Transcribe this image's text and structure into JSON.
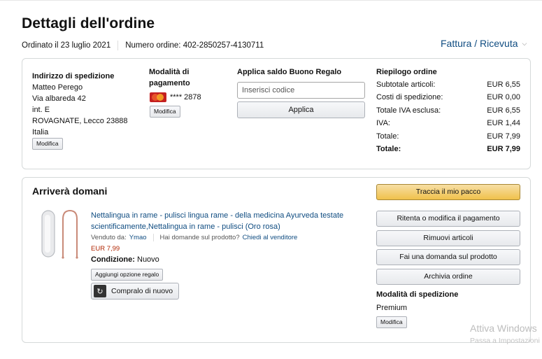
{
  "page": {
    "title": "Dettagli dell'ordine",
    "order_date": "Ordinato il 23 luglio 2021",
    "order_number": "Numero ordine: 402-2850257-4130711",
    "invoice_link": "Fattura / Ricevuta"
  },
  "shipping_address": {
    "label": "Indirizzo di spedizione",
    "lines": [
      "Matteo Perego",
      "Via albareda 42",
      "int. E",
      "ROVAGNATE, Lecco 23888",
      "Italia"
    ],
    "edit_button": "Modifica"
  },
  "payment": {
    "label": "Modalità di pagamento",
    "card_masked": "**** 2878",
    "card_brand_icon": "mastercard-icon",
    "edit_button": "Modifica"
  },
  "gift_card": {
    "label": "Applica saldo Buono Regalo",
    "placeholder": "Inserisci codice",
    "value": "",
    "apply_button": "Applica"
  },
  "summary": {
    "label": "Riepilogo ordine",
    "rows": [
      {
        "name": "Subtotale articoli:",
        "value": "EUR 6,55"
      },
      {
        "name": "Costi di spedizione:",
        "value": "EUR 0,00"
      },
      {
        "name": "Totale IVA esclusa:",
        "value": "EUR 6,55"
      },
      {
        "name": "IVA:",
        "value": "EUR 1,44"
      },
      {
        "name": "Totale:",
        "value": "EUR 7,99"
      }
    ],
    "grand_total": {
      "name": "Totale:",
      "value": "EUR 7,99"
    }
  },
  "shipment": {
    "heading": "Arriverà domani",
    "product": {
      "title": "Nettalingua in rame - pulisci lingua rame - della medicina Ayurveda testate scientificamente,Nettalingua in rame - pulisci (Oro rosa)",
      "sold_by_label": "Venduto da:",
      "seller": "Ymao",
      "question_label": "Hai domande sul prodotto?",
      "contact_seller": "Chiedi al venditore",
      "price": "EUR 7,99",
      "condition_label": "Condizione:",
      "condition_value": "Nuovo",
      "gift_option_button": "Aggiungi opzione regalo",
      "buy_again_button": "Compralo di nuovo"
    },
    "actions": {
      "track": "Traccia il mio pacco",
      "retry_payment": "Ritenta o modifica il pagamento",
      "remove_items": "Rimuovi articoli",
      "ask_question": "Fai una domanda sul prodotto",
      "archive": "Archivia ordine"
    },
    "shipping_method_label": "Modalità di spedizione",
    "shipping_method_value": "Premium",
    "shipping_edit_button": "Modifica"
  },
  "watermark": {
    "line1": "Attiva Windows",
    "line2": "Passa a Impostazioni"
  },
  "colors": {
    "link": "#0f4c81",
    "price": "#b12704",
    "primary_button": "#f0c14b"
  }
}
